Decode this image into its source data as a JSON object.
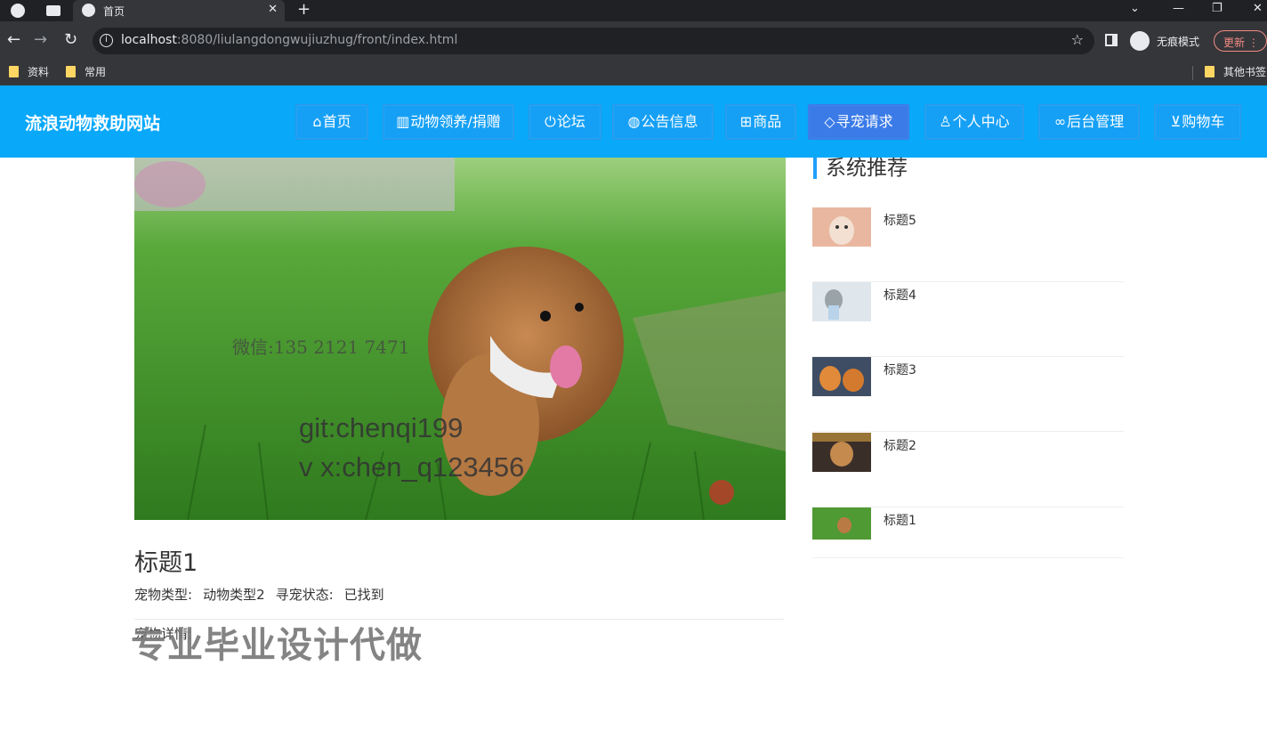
{
  "browser": {
    "tab_title": "首页",
    "url_host": "localhost",
    "url_rest": ":8080/liulangdongwujiuzhug/front/index.html",
    "incognito_label": "无痕模式",
    "update_label": "更新",
    "bookmarks": [
      "资料",
      "常用"
    ],
    "other_bookmarks": "其他书签"
  },
  "site": {
    "logo": "流浪动物救助网站",
    "nav": [
      {
        "label": "首页",
        "icon": "home-icon"
      },
      {
        "label": "动物领养/捐赠",
        "icon": "grid-icon"
      },
      {
        "label": "论坛",
        "icon": "power-icon"
      },
      {
        "label": "公告信息",
        "icon": "globe-icon"
      },
      {
        "label": "商品",
        "icon": "book-icon"
      },
      {
        "label": "寻宠请求",
        "icon": "tag-icon"
      },
      {
        "label": "个人中心",
        "icon": "user-icon"
      },
      {
        "label": "后台管理",
        "icon": "link-icon"
      },
      {
        "label": "购物车",
        "icon": "cart-icon"
      }
    ],
    "active_nav": "寻宠请求"
  },
  "post": {
    "image_overlay": {
      "line1": "微信:135 2121 7471",
      "line2": "git:chenqi199",
      "line3": "v x:chen_q123456"
    },
    "title": "标题1",
    "pet_type_label": "宠物类型:",
    "pet_type_value": "动物类型2",
    "status_label": "寻宠状态:",
    "status_value": "已找到",
    "detail_label": "宠物详情:",
    "watermark": "专业毕业设计代做"
  },
  "sidebar": {
    "title": "系统推荐",
    "items": [
      {
        "label": "标题5"
      },
      {
        "label": "标题4"
      },
      {
        "label": "标题3"
      },
      {
        "label": "标题2"
      },
      {
        "label": "标题1"
      }
    ]
  },
  "colors": {
    "header_bg": "#09a8f9",
    "nav_active": "#3a7be8",
    "accent_bar": "#1e9fff"
  }
}
